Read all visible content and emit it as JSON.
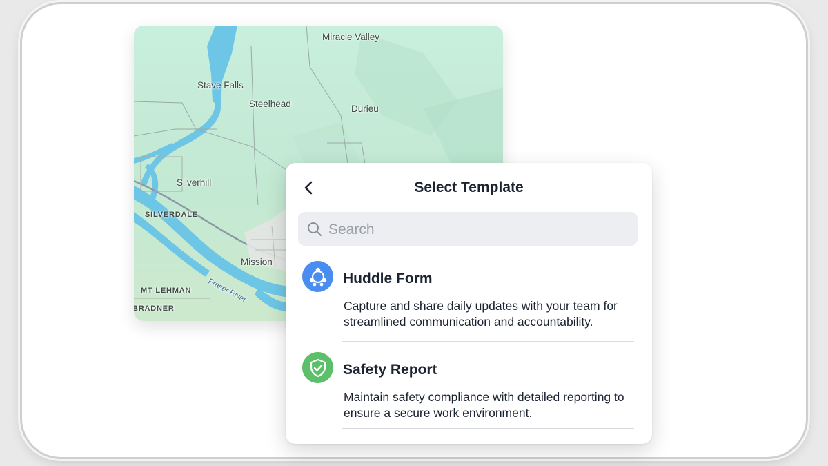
{
  "map": {
    "labels": {
      "miracle_valley": "Miracle Valley",
      "stave_falls": "Stave Falls",
      "steelhead": "Steelhead",
      "durieu": "Durieu",
      "silverhill": "Silverhill",
      "silverdale": "SILVERDALE",
      "mission": "Mission",
      "mt_lehman": "MT LEHMAN",
      "bradner": "BRADNER",
      "fraser_river": "Fraser River"
    }
  },
  "dialog": {
    "title": "Select Template",
    "search": {
      "placeholder": "Search",
      "value": ""
    },
    "templates": [
      {
        "title": "Huddle Form",
        "description": "Capture and share daily updates with your team for streamlined communication and accountability.",
        "icon": "team-huddle-icon",
        "icon_color": "#4a8df0"
      },
      {
        "title": "Safety Report",
        "description": "Maintain safety compliance with detailed reporting to ensure a secure work environment.",
        "icon": "shield-check-icon",
        "icon_color": "#5cbf6a"
      }
    ]
  }
}
